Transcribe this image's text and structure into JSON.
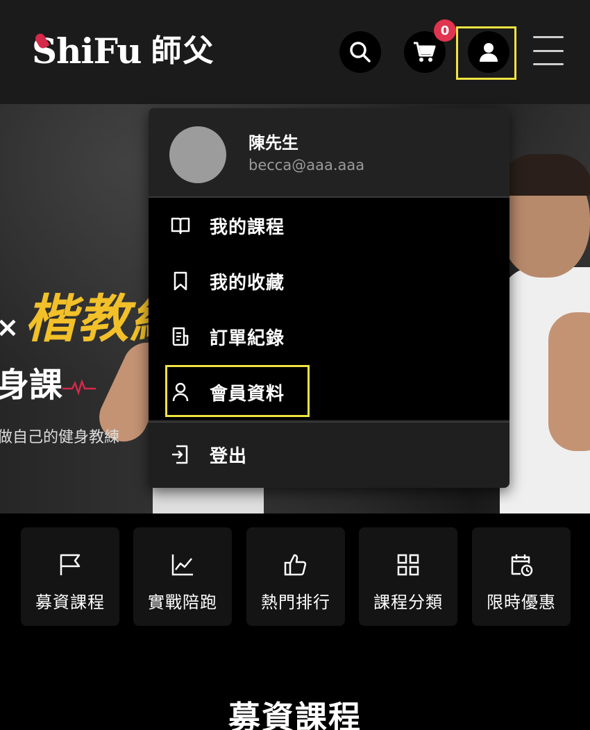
{
  "header": {
    "logo_text": "ShiFu",
    "logo_cn": "師父",
    "cart_count": "0",
    "icons": {
      "search": "search-icon",
      "cart": "cart-icon",
      "user": "user-icon",
      "menu": "menu-icon"
    }
  },
  "hero": {
    "title": "楷教練",
    "title_prefix": "×",
    "subtitle": "身課",
    "description": "做自己的健身教練"
  },
  "user_menu": {
    "name": "陳先生",
    "email": "becca@aaa.aaa",
    "items": [
      {
        "label": "我的課程",
        "icon": "book-icon"
      },
      {
        "label": "我的收藏",
        "icon": "bookmark-icon"
      },
      {
        "label": "訂單紀錄",
        "icon": "receipt-icon"
      },
      {
        "label": "會員資料",
        "icon": "person-icon"
      }
    ],
    "logout": {
      "label": "登出",
      "icon": "logout-icon"
    }
  },
  "categories": [
    {
      "label": "募資課程",
      "icon": "flag-icon"
    },
    {
      "label": "實戰陪跑",
      "icon": "chart-icon"
    },
    {
      "label": "熱門排行",
      "icon": "thumbs-up-icon"
    },
    {
      "label": "課程分類",
      "icon": "grid-icon"
    },
    {
      "label": "限時優惠",
      "icon": "calendar-clock-icon"
    }
  ],
  "section": {
    "title": "募資課程"
  },
  "colors": {
    "highlight": "#f0e442",
    "badge": "#e0344f",
    "hero_accent": "#f2c029",
    "pulse": "#d6294a"
  }
}
